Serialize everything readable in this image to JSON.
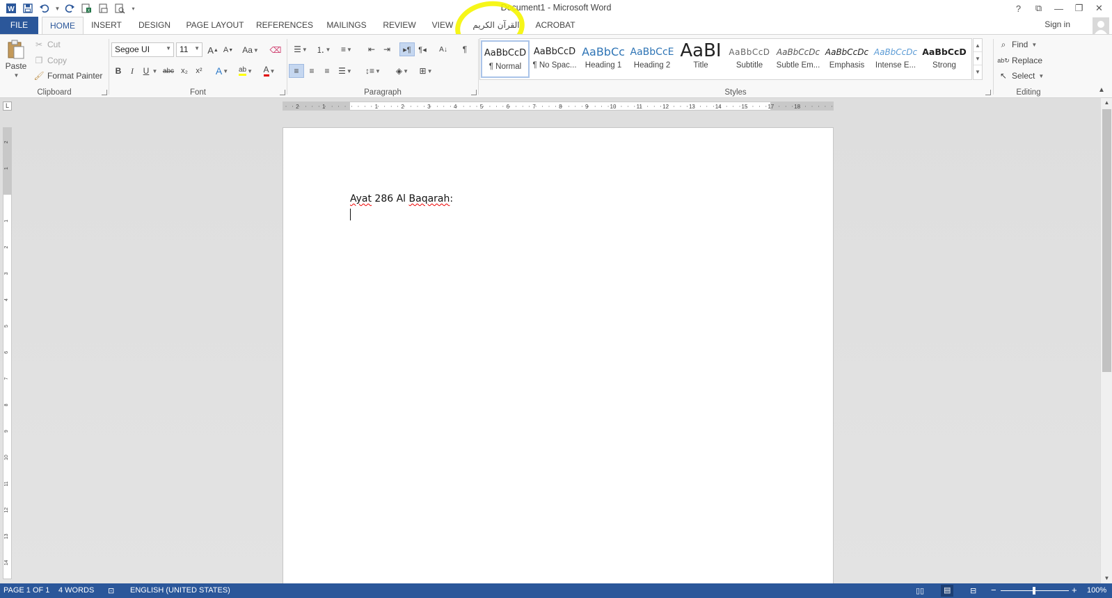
{
  "window": {
    "title": "Document1 - Microsoft Word",
    "help": "?",
    "ribbon_display": "⧉",
    "minimize": "—",
    "maximize": "❐",
    "close": "✕"
  },
  "tabs": {
    "file": "FILE",
    "home": "HOME",
    "insert": "INSERT",
    "design": "DESIGN",
    "page_layout": "PAGE LAYOUT",
    "references": "REFERENCES",
    "mailings": "MAILINGS",
    "review": "REVIEW",
    "view": "VIEW",
    "quran": "القرآن الكريم",
    "acrobat": "ACROBAT"
  },
  "account": {
    "sign_in": "Sign in"
  },
  "clipboard": {
    "label": "Clipboard",
    "paste": "Paste",
    "cut": "Cut",
    "copy": "Copy",
    "format_painter": "Format Painter"
  },
  "font": {
    "label": "Font",
    "family": "Segoe UI",
    "size": "11",
    "grow": "A",
    "shrink": "A",
    "change_case": "Aa",
    "bold": "B",
    "italic": "I",
    "underline": "U",
    "strikethrough": "abc",
    "subscript": "x₂",
    "superscript": "x²",
    "highlight": "ab",
    "font_color": "A",
    "font_color_hex": "#e00000",
    "highlight_hex": "#ffff00"
  },
  "paragraph": {
    "label": "Paragraph"
  },
  "styles": {
    "label": "Styles",
    "items": [
      {
        "sample": "AaBbCcD",
        "name": "¶ Normal"
      },
      {
        "sample": "AaBbCcD",
        "name": "¶ No Spac..."
      },
      {
        "sample": "AaBbCc",
        "name": "Heading 1"
      },
      {
        "sample": "AaBbCcE",
        "name": "Heading 2"
      },
      {
        "sample": "AaBI",
        "name": "Title"
      },
      {
        "sample": "AaBbCcD",
        "name": "Subtitle"
      },
      {
        "sample": "AaBbCcDc",
        "name": "Subtle Em..."
      },
      {
        "sample": "AaBbCcDc",
        "name": "Emphasis"
      },
      {
        "sample": "AaBbCcDc",
        "name": "Intense E..."
      },
      {
        "sample": "AaBbCcD",
        "name": "Strong"
      }
    ]
  },
  "editing": {
    "label": "Editing",
    "find": "Find",
    "replace": "Replace",
    "select": "Select"
  },
  "ruler": {
    "h_ticks": [
      "2",
      "1",
      "1",
      "2",
      "3",
      "4",
      "5",
      "6",
      "7",
      "8",
      "9",
      "10",
      "11",
      "12",
      "13",
      "14",
      "15",
      "17",
      "18"
    ],
    "v_ticks": [
      "2",
      "1",
      "1",
      "2",
      "3",
      "4",
      "5",
      "6",
      "7",
      "8",
      "9",
      "10",
      "11",
      "12",
      "13",
      "14"
    ],
    "tab_selector": "L"
  },
  "document": {
    "line1_word1": "Ayat",
    "line1_rest": " 286 Al ",
    "line1_word2": "Baqarah",
    "line1_end": ":"
  },
  "status": {
    "page": "PAGE 1 OF 1",
    "words": "4 WORDS",
    "language": "ENGLISH (UNITED STATES)",
    "zoom": "100%",
    "zoom_out": "−",
    "zoom_in": "+"
  },
  "colors": {
    "brand": "#2b579a",
    "highlight_ring": "#f5f500",
    "spell_error": "#e00000"
  }
}
